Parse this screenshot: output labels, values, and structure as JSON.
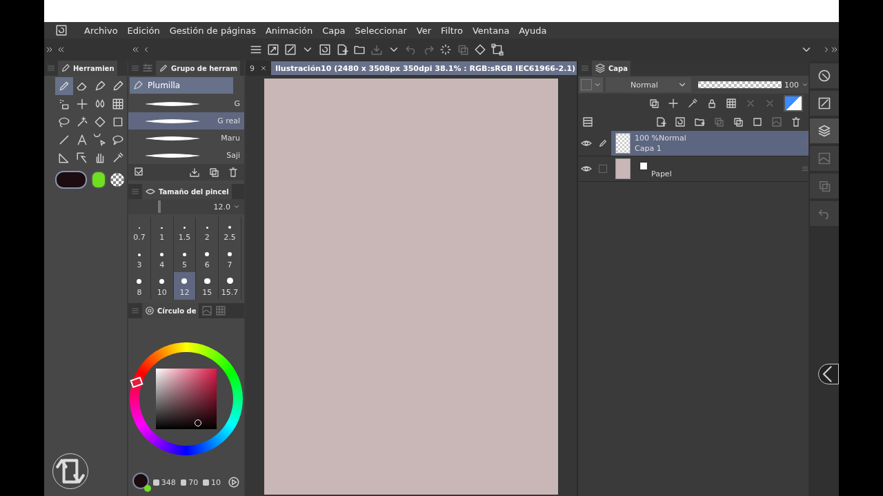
{
  "menu": [
    "Archivo",
    "Edición",
    "Gestión de páginas",
    "Animación",
    "Capa",
    "Seleccionar",
    "Ver",
    "Filtro",
    "Ventana",
    "Ayuda"
  ],
  "tool_palette": {
    "tab": "Herramien",
    "tools": [
      {
        "selected": true
      },
      {
        "selected": false
      },
      {
        "selected": false
      },
      {
        "selected": false
      },
      {
        "selected": false
      },
      {
        "selected": false
      },
      {
        "selected": false
      },
      {
        "selected": false
      },
      {
        "selected": false
      },
      {
        "selected": false
      },
      {
        "selected": false
      },
      {
        "selected": false
      },
      {
        "selected": false
      },
      {
        "selected": false
      },
      {
        "selected": false
      },
      {
        "selected": false
      },
      {
        "selected": false
      },
      {
        "selected": false
      },
      {
        "selected": false
      },
      {
        "selected": false
      }
    ],
    "colors": [
      {
        "color": "#1c0b0f"
      },
      {
        "color": "#6ee020"
      }
    ]
  },
  "sub_tool": {
    "tab": "Grupo de herram",
    "group": "Plumilla",
    "brushes": [
      {
        "label": "G",
        "selected": false
      },
      {
        "label": "G real",
        "selected": true
      },
      {
        "label": "Maru",
        "selected": false
      },
      {
        "label": "Saji",
        "selected": false
      }
    ]
  },
  "brush_size": {
    "title": "Tamaño del pincel",
    "value": "12.0",
    "level": 0.33,
    "sizes": [
      {
        "label": "0.7",
        "selected": false
      },
      {
        "label": "1",
        "selected": false
      },
      {
        "label": "1.5",
        "selected": false
      },
      {
        "label": "2",
        "selected": false
      },
      {
        "label": "2.5",
        "selected": false
      },
      {
        "label": "3",
        "selected": false
      },
      {
        "label": "4",
        "selected": false
      },
      {
        "label": "5",
        "selected": false
      },
      {
        "label": "6",
        "selected": false
      },
      {
        "label": "7",
        "selected": false
      },
      {
        "label": "8",
        "selected": false
      },
      {
        "label": "10",
        "selected": false
      },
      {
        "label": "12",
        "selected": true
      },
      {
        "label": "15",
        "selected": false
      },
      {
        "label": "15.7",
        "selected": false
      }
    ]
  },
  "color_wheel": {
    "title": "Círculo de",
    "h": "348",
    "s": "70",
    "v": "10",
    "main": {
      "color": "#1c0b0f"
    },
    "sub": {
      "color": "#6ee020"
    }
  },
  "canvas": {
    "tabs": [
      {
        "label": "9",
        "selected": false
      },
      {
        "label": "Ilustración10 (2480 x 3508px 350dpi 38.1% : RGB:sRGB IEC61966-2.1)",
        "selected": true
      }
    ]
  },
  "layers": {
    "title": "Capa",
    "blend_mode": "Normal",
    "opacity": "100",
    "opacity_slider": {
      "level": 1
    },
    "items": [
      {
        "kind": "raster",
        "info": "100 %Normal",
        "name": "Capa 1",
        "selected": true,
        "visible": true
      },
      {
        "kind": "paper",
        "name": "Papel",
        "selected": false,
        "visible": true
      }
    ]
  }
}
